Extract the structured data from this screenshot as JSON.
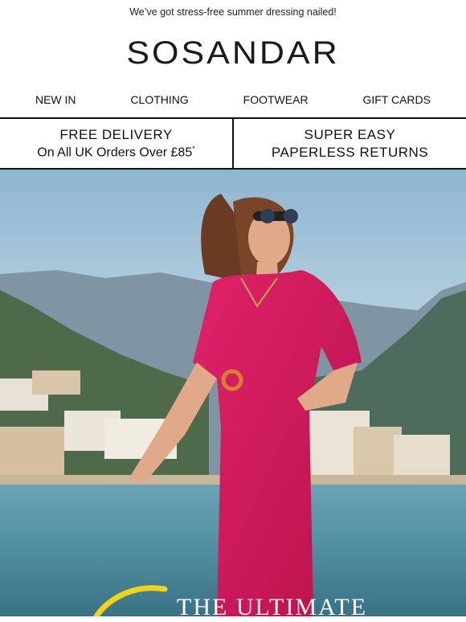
{
  "preheader": {
    "text": "We’ve got stress-free summer dressing nailed!"
  },
  "brand": {
    "logo_text": "SOSANDAR"
  },
  "nav": {
    "items": [
      {
        "label": "NEW IN"
      },
      {
        "label": "CLOTHING"
      },
      {
        "label": "FOOTWEAR"
      },
      {
        "label": "GIFT CARDS"
      }
    ]
  },
  "usp": {
    "delivery": {
      "title": "FREE DELIVERY",
      "subtitle": "On All UK Orders Over £85",
      "mark": "*"
    },
    "returns": {
      "line1": "SUPER EASY",
      "line2": "PAPERLESS RETURNS"
    }
  },
  "hero": {
    "title": "THE ULTIMATE",
    "colors": {
      "jumpsuit": "#d6195a",
      "sky": "#a9c8dc",
      "sea": "#4f8ea0",
      "headline": "#ffffff",
      "accent_script": "#f3d21a"
    }
  }
}
